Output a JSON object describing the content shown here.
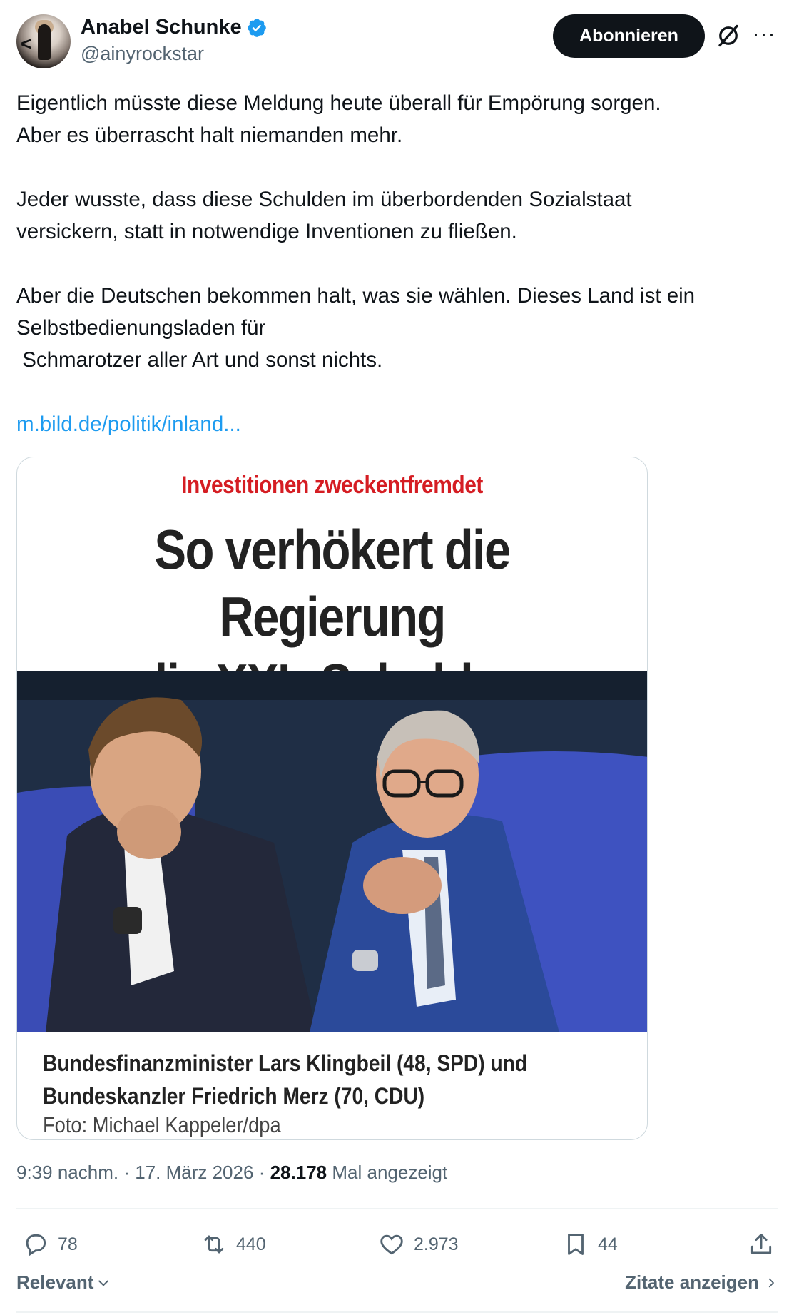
{
  "author": {
    "name": "Anabel Schunke",
    "handle": "@ainyrockstar",
    "verified": true,
    "verified_color": "#1d9bf0"
  },
  "header": {
    "follow_label": "Abonnieren",
    "grok_icon": "grok-icon",
    "more_icon": "more-icon"
  },
  "tweet": {
    "paragraphs": [
      "Eigentlich müsste diese Meldung heute überall für Empörung sorgen.\nAber es überrascht halt niemanden mehr.",
      "Jeder wusste, dass diese Schulden im überbordenden Sozialstaat\nversickern, statt in notwendige Inventionen zu fließen.",
      "Aber die Deutschen bekommen halt, was sie wählen. Dieses Land ist ein\nSelbstbedienungsladen für\n Schmarotzer aller Art und sonst nichts."
    ],
    "link": "m.bild.de/politik/inland..."
  },
  "card": {
    "kicker": "Investitionen zweckentfremdet",
    "headline_line1": "So verhökert die Regierung",
    "headline_line2": "die XXL-Schulden",
    "caption_line1": "Bundesfinanzminister Lars Klingbeil (48, SPD) und",
    "caption_line2": "Bundeskanzler Friedrich Merz (70, CDU)",
    "photo_credit": "Foto: Michael Kappeler/dpa"
  },
  "meta": {
    "time": "9:39 nachm.",
    "separator": "·",
    "date": "17. März 2026",
    "views_count": "28.178",
    "views_label": "Mal angezeigt"
  },
  "actions": {
    "replies": "78",
    "reposts": "440",
    "likes": "2.973",
    "bookmarks": "44"
  },
  "footer": {
    "sort_label": "Relevant",
    "quotes_label": "Zitate anzeigen"
  },
  "colors": {
    "accent": "#1d9bf0",
    "text": "#0f1419",
    "secondary": "#536471",
    "kicker_red": "#d51d23"
  }
}
